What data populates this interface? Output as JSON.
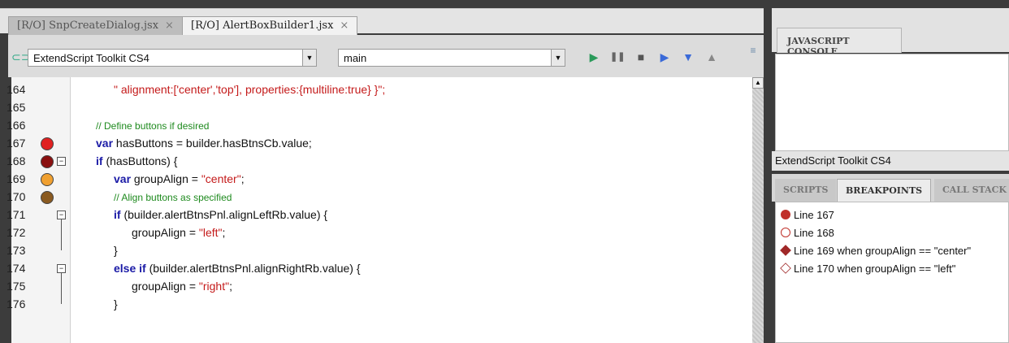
{
  "tabs": [
    {
      "label": "[R/O] SnpCreateDialog.jsx",
      "close": "×"
    },
    {
      "label": "[R/O] AlertBoxBuilder1.jsx",
      "close": "×"
    }
  ],
  "toolbar": {
    "target_app": "ExtendScript Toolkit CS4",
    "function": "main",
    "icons": [
      "link-icon",
      "run-icon",
      "pause-icon",
      "stop-icon",
      "step-over-icon",
      "step-into-icon",
      "step-out-icon",
      "panel-menu-icon"
    ]
  },
  "code": {
    "lines": [
      {
        "num": "164",
        "html_parts": [
          {
            "t": "str",
            "v": "\" alignment:['center','top'], properties:{multiline:true} }\";"
          }
        ],
        "indent": 3
      },
      {
        "num": "165",
        "html_parts": [],
        "indent": 0
      },
      {
        "num": "166",
        "html_parts": [
          {
            "t": "cm",
            "v": "// Define buttons if desired"
          }
        ],
        "indent": 2
      },
      {
        "num": "167",
        "html_parts": [
          {
            "t": "kw",
            "v": "var"
          },
          {
            "t": "p",
            "v": " hasButtons = builder.hasBtnsCb.value;"
          }
        ],
        "indent": 2
      },
      {
        "num": "168",
        "html_parts": [
          {
            "t": "kw",
            "v": "if"
          },
          {
            "t": "p",
            "v": " (hasButtons) {"
          }
        ],
        "indent": 2
      },
      {
        "num": "169",
        "html_parts": [
          {
            "t": "kw",
            "v": "var"
          },
          {
            "t": "p",
            "v": " groupAlign = "
          },
          {
            "t": "str",
            "v": "\"center\""
          },
          {
            "t": "p",
            "v": ";"
          }
        ],
        "indent": 3
      },
      {
        "num": "170",
        "html_parts": [
          {
            "t": "cm",
            "v": "// Align buttons as specified"
          }
        ],
        "indent": 3
      },
      {
        "num": "171",
        "html_parts": [
          {
            "t": "kw",
            "v": "if"
          },
          {
            "t": "p",
            "v": " (builder.alertBtnsPnl.alignLeftRb.value) {"
          }
        ],
        "indent": 3
      },
      {
        "num": "172",
        "html_parts": [
          {
            "t": "p",
            "v": "groupAlign = "
          },
          {
            "t": "str",
            "v": "\"left\""
          },
          {
            "t": "p",
            "v": ";"
          }
        ],
        "indent": 4
      },
      {
        "num": "173",
        "html_parts": [
          {
            "t": "p",
            "v": "}"
          }
        ],
        "indent": 3
      },
      {
        "num": "174",
        "html_parts": [
          {
            "t": "kw",
            "v": "else if"
          },
          {
            "t": "p",
            "v": " (builder.alertBtnsPnl.alignRightRb.value) {"
          }
        ],
        "indent": 3
      },
      {
        "num": "175",
        "html_parts": [
          {
            "t": "p",
            "v": "groupAlign = "
          },
          {
            "t": "str",
            "v": "\"right\""
          },
          {
            "t": "p",
            "v": ";"
          }
        ],
        "indent": 4
      },
      {
        "num": "176",
        "html_parts": [
          {
            "t": "p",
            "v": "}"
          }
        ],
        "indent": 3
      }
    ],
    "breakpoints": {
      "167": {
        "color": "#e02020",
        "kind": "enabled"
      },
      "168": {
        "color": "#8a1010",
        "kind": "enabled-dark"
      },
      "169": {
        "color": "#f0a030",
        "kind": "conditional"
      },
      "170": {
        "color": "#8a5a20",
        "kind": "conditional-dark"
      }
    },
    "folds": [
      "168",
      "171",
      "174"
    ]
  },
  "console": {
    "title": "JAVASCRIPT CONSOLE",
    "target": "ExtendScript Toolkit CS4"
  },
  "debug_tabs": [
    "SCRIPTS",
    "BREAKPOINTS",
    "CALL STACK"
  ],
  "breakpoint_list": [
    {
      "label": "Line 167",
      "icon": "filled-circle",
      "color": "#c0302a"
    },
    {
      "label": "Line 168",
      "icon": "hollow-circle",
      "color": "#c0302a"
    },
    {
      "label": "Line 169 when groupAlign == \"center\"",
      "icon": "filled-diamond",
      "color": "#a02828"
    },
    {
      "label": "Line 170 when groupAlign == \"left\"",
      "icon": "hollow-diamond",
      "color": "#a02828"
    }
  ]
}
